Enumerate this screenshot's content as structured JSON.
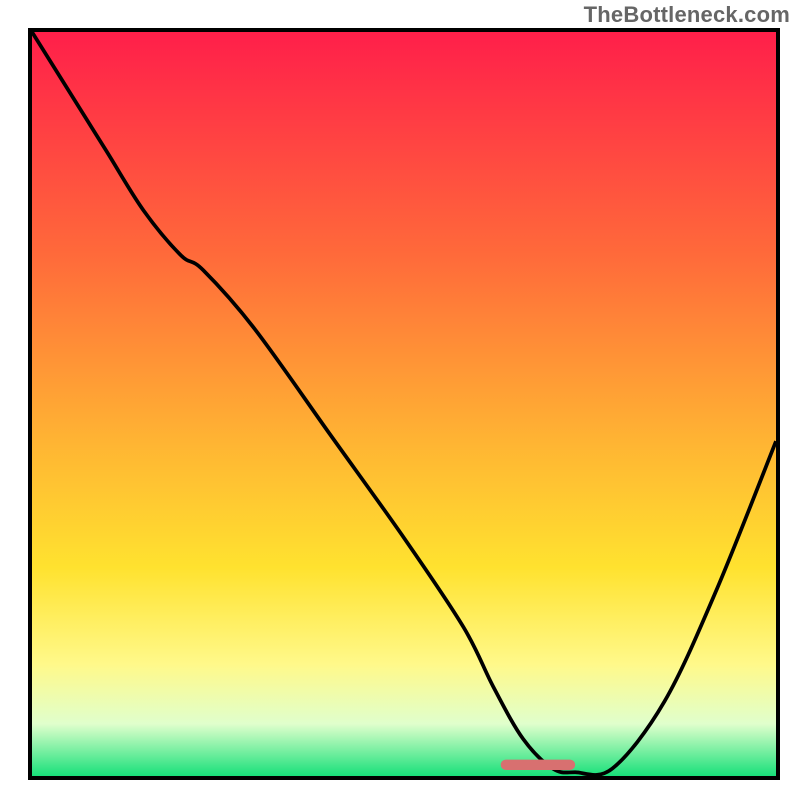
{
  "watermark": "TheBottleneck.com",
  "colors": {
    "border": "#000000",
    "curve": "#000000",
    "marker": "#d87070",
    "grad_top": "#ff1f4a",
    "grad_mid1": "#ff6a3a",
    "grad_mid2": "#ffb433",
    "grad_mid3": "#ffe22f",
    "grad_low1": "#fff98a",
    "grad_low2": "#e0ffcc",
    "grad_bottom": "#18e07a"
  },
  "chart_data": {
    "type": "line",
    "title": "",
    "xlabel": "",
    "ylabel": "",
    "xlim": [
      0,
      100
    ],
    "ylim": [
      0,
      100
    ],
    "x": [
      0,
      5,
      10,
      15,
      20,
      23,
      30,
      40,
      50,
      58,
      62,
      66,
      70,
      73,
      78,
      85,
      92,
      100
    ],
    "y": [
      100,
      92,
      84,
      76,
      70,
      68,
      60,
      46,
      32,
      20,
      12,
      5,
      1,
      0.5,
      1,
      10,
      25,
      45
    ],
    "marker": {
      "x_start": 63,
      "x_end": 73,
      "y": 1.5
    },
    "gradient_stops": [
      {
        "pct": 0,
        "color_key": "grad_top"
      },
      {
        "pct": 30,
        "color_key": "grad_mid1"
      },
      {
        "pct": 55,
        "color_key": "grad_mid2"
      },
      {
        "pct": 72,
        "color_key": "grad_mid3"
      },
      {
        "pct": 85,
        "color_key": "grad_low1"
      },
      {
        "pct": 93,
        "color_key": "grad_low2"
      },
      {
        "pct": 100,
        "color_key": "grad_bottom"
      }
    ]
  }
}
